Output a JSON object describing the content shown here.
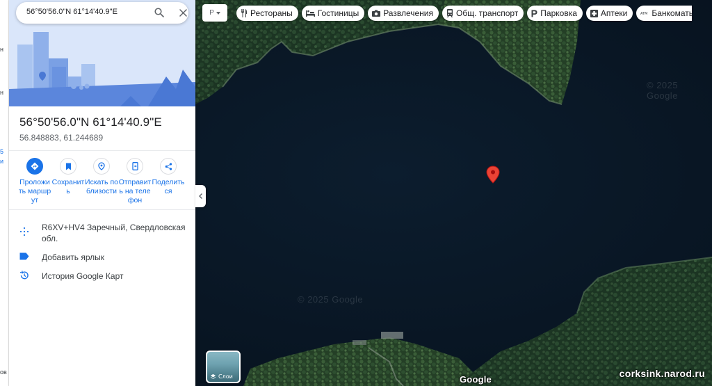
{
  "search": {
    "value": "56°50'56.0\"N 61°14'40.9\"E"
  },
  "place": {
    "title": "56°50'56.0\"N 61°14'40.9\"E",
    "coordinates": "56.848883, 61.244689"
  },
  "actions": [
    {
      "label": "Проложить маршрут",
      "icon": "directions-icon"
    },
    {
      "label": "Сохранить",
      "icon": "bookmark-icon"
    },
    {
      "label": "Искать поблизости",
      "icon": "nearby-icon"
    },
    {
      "label": "Отправить на телефон",
      "icon": "phone-icon"
    },
    {
      "label": "Поделиться",
      "icon": "share-icon"
    }
  ],
  "info": {
    "plus_code": "R6XV+HV4 Заречный, Свердловская обл.",
    "add_label": "Добавить ярлык",
    "history": "История Google Карт"
  },
  "map": {
    "mode_label": "Р",
    "watermark": "© 2025 Google",
    "google_logo": "Google",
    "site_credit": "corksink.narod.ru",
    "layers_label": "Слои",
    "pin_color": "#ea4335"
  },
  "chips": [
    {
      "label": "Рестораны",
      "icon": "restaurant-icon"
    },
    {
      "label": "Гостиницы",
      "icon": "hotel-icon"
    },
    {
      "label": "Развлечения",
      "icon": "camera-icon"
    },
    {
      "label": "Общ. транспорт",
      "icon": "transit-icon"
    },
    {
      "label": "Парковка",
      "icon": "parking-icon"
    },
    {
      "label": "Аптеки",
      "icon": "pharmacy-icon"
    },
    {
      "label": "Банкоматы",
      "icon": "atm-icon"
    }
  ],
  "strip": {
    "fragments": [
      "н",
      "н",
      "5",
      "и",
      "ов"
    ]
  },
  "colors": {
    "accent": "#1a73e8",
    "water": "#0a1a2a",
    "forest": "#1f3a24"
  }
}
